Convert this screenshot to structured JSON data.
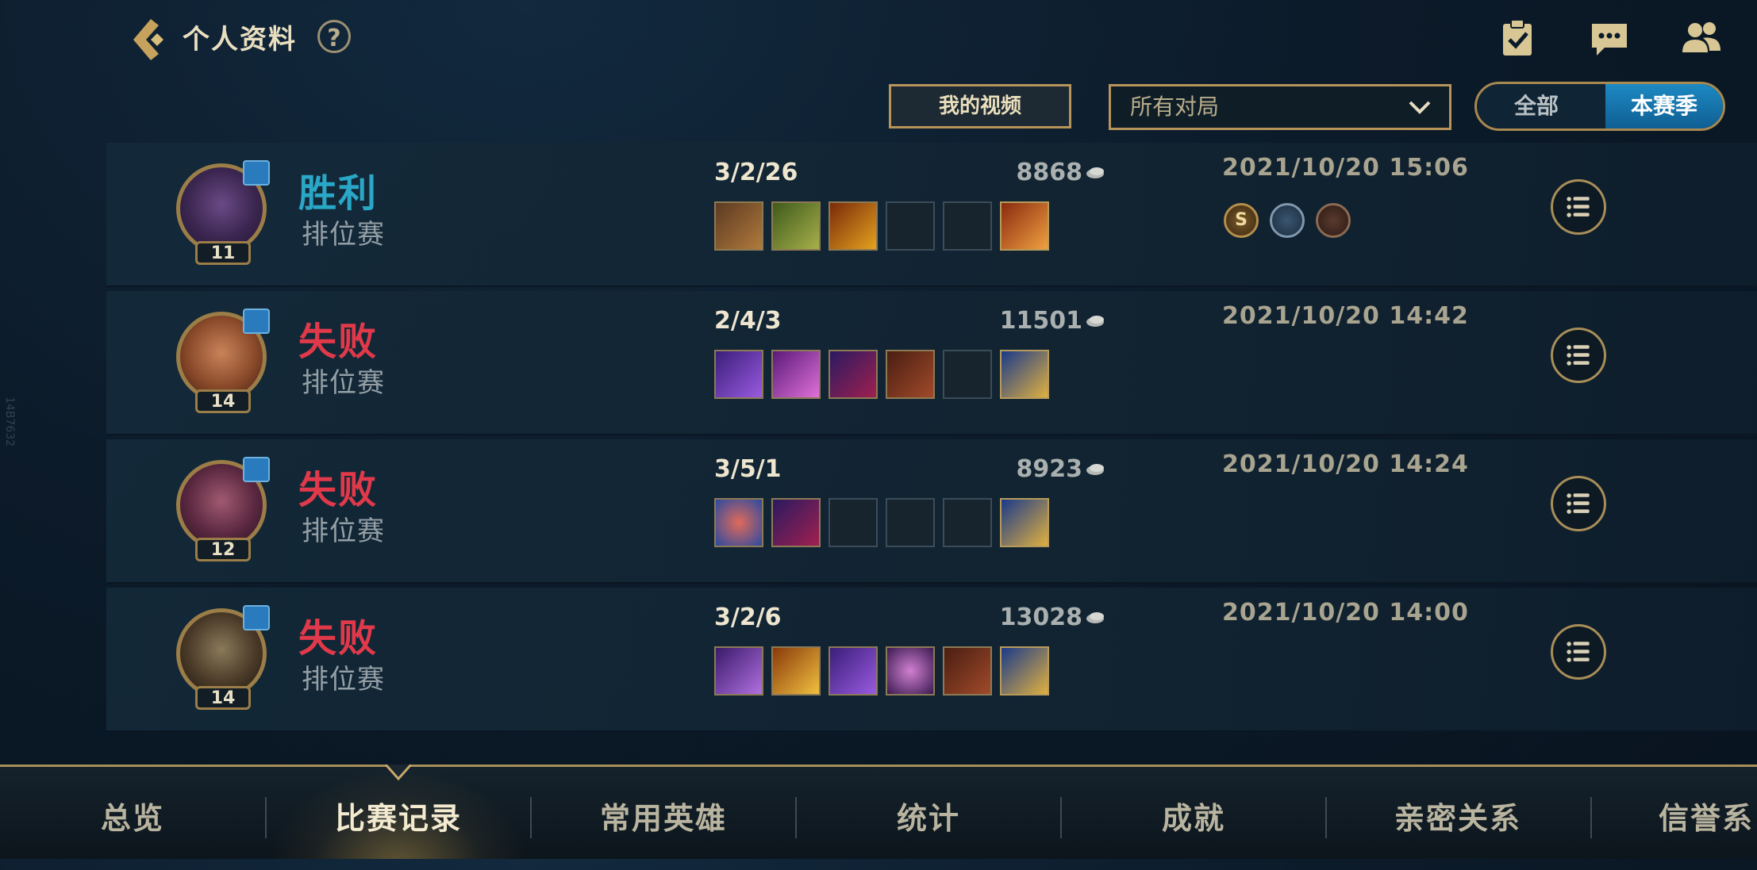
{
  "header": {
    "title": "个人资料",
    "help_symbol": "?",
    "icons": [
      "clipboard-check-icon",
      "chat-icon",
      "friends-icon"
    ]
  },
  "filters": {
    "my_videos": "我的视频",
    "match_type_selected": "所有对局",
    "toggle": {
      "all": "全部",
      "season": "本赛季",
      "selected": "本赛季"
    }
  },
  "matches": [
    {
      "result": "胜利",
      "result_color": "#2aa7c6",
      "mode": "排位赛",
      "level": "11",
      "kda": "3/2/26",
      "gold": "8868",
      "datetime": "2021/10/20 15:06",
      "badges": [
        "s-rank-badge",
        "flag-badge",
        "hand-badge"
      ]
    },
    {
      "result": "失败",
      "result_color": "#e0394a",
      "mode": "排位赛",
      "level": "14",
      "kda": "2/4/3",
      "gold": "11501",
      "datetime": "2021/10/20 14:42",
      "badges": []
    },
    {
      "result": "失败",
      "result_color": "#e0394a",
      "mode": "排位赛",
      "level": "12",
      "kda": "3/5/1",
      "gold": "8923",
      "datetime": "2021/10/20 14:24",
      "badges": []
    },
    {
      "result": "失败",
      "result_color": "#e0394a",
      "mode": "排位赛",
      "level": "14",
      "kda": "3/2/6",
      "gold": "13028",
      "datetime": "2021/10/20 14:00",
      "badges": []
    }
  ],
  "side_text": "14B7632",
  "nav": {
    "tabs": [
      "总览",
      "比赛记录",
      "常用英雄",
      "统计",
      "成就",
      "亲密关系",
      "信誉系"
    ],
    "active": "比赛记录"
  },
  "colors": {
    "accent_gold": "#b7945a",
    "toggle_blue": "#1d89c2",
    "win": "#2aa7c6",
    "loss": "#e0394a"
  }
}
